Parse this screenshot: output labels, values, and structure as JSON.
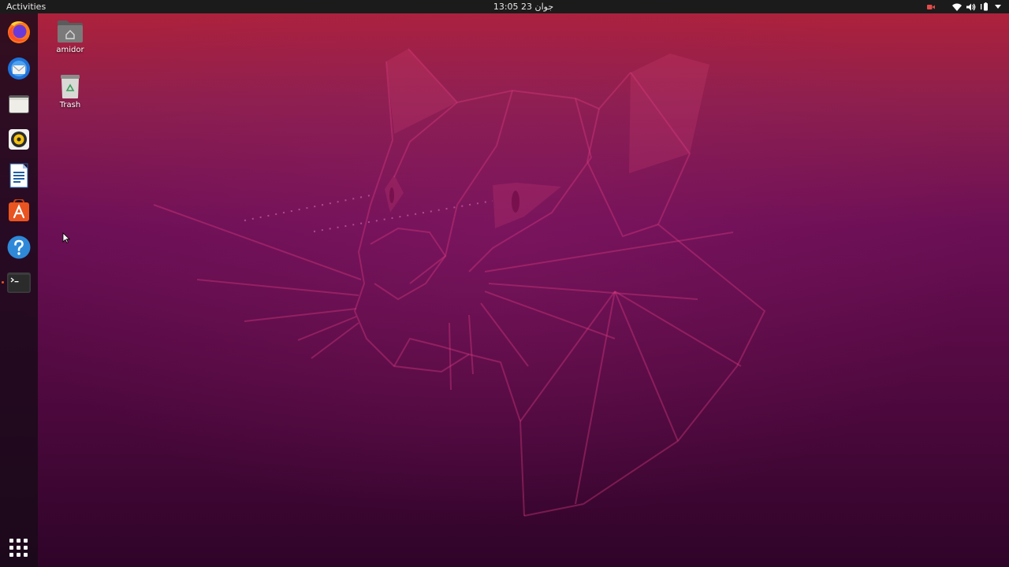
{
  "topbar": {
    "activities_label": "Activities",
    "clock": "جوان 23  13:05",
    "tray_icons": [
      "camera-indicator-icon",
      "wifi-icon",
      "volume-icon",
      "battery-icon",
      "system-menu-chevron-icon"
    ]
  },
  "dock": {
    "items": [
      {
        "name": "firefox-icon",
        "running": false
      },
      {
        "name": "thunderbird-icon",
        "running": false
      },
      {
        "name": "files-icon",
        "running": false
      },
      {
        "name": "rhythmbox-icon",
        "running": false
      },
      {
        "name": "libreoffice-writer-icon",
        "running": false
      },
      {
        "name": "ubuntu-software-icon",
        "running": false
      },
      {
        "name": "help-icon",
        "running": false
      },
      {
        "name": "terminal-icon",
        "running": true
      }
    ],
    "show_apps_icon": "apps-grid-icon"
  },
  "desktop": {
    "icons": [
      {
        "label": "amidor",
        "icon": "home-folder-icon"
      },
      {
        "label": "Trash",
        "icon": "trash-icon"
      }
    ]
  },
  "colors": {
    "topbar_bg": "#1b1b1b",
    "accent": "#e95420",
    "wallpaper_top": "#b22239",
    "wallpaper_bottom": "#2f0429"
  }
}
